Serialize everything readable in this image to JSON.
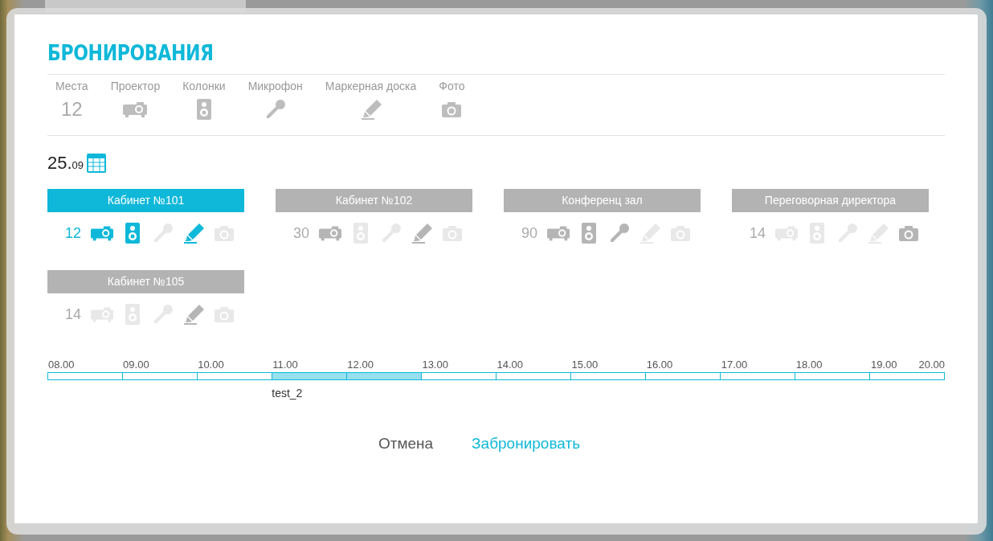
{
  "dialog": {
    "title": "БРОНИРОВАНИЯ",
    "legend": [
      {
        "kind": "seats",
        "label": "Места",
        "value": "12"
      },
      {
        "kind": "projector",
        "label": "Проектор"
      },
      {
        "kind": "speaker",
        "label": "Колонки"
      },
      {
        "kind": "mic",
        "label": "Микрофон"
      },
      {
        "kind": "marker",
        "label": "Маркерная доска"
      },
      {
        "kind": "camera",
        "label": "Фото"
      }
    ],
    "date": {
      "day": "25.",
      "month": "09"
    },
    "rooms": [
      {
        "name": "Кабинет №101",
        "selected": true,
        "seats": "12",
        "features": [
          {
            "kind": "projector",
            "available": true
          },
          {
            "kind": "speaker",
            "available": true
          },
          {
            "kind": "mic",
            "available": false
          },
          {
            "kind": "marker",
            "available": true
          },
          {
            "kind": "camera",
            "available": false
          }
        ]
      },
      {
        "name": "Кабинет №102",
        "selected": false,
        "seats": "30",
        "features": [
          {
            "kind": "projector",
            "available": true
          },
          {
            "kind": "speaker",
            "available": false
          },
          {
            "kind": "mic",
            "available": false
          },
          {
            "kind": "marker",
            "available": true
          },
          {
            "kind": "camera",
            "available": false
          }
        ]
      },
      {
        "name": "Конференц зал",
        "selected": false,
        "seats": "90",
        "features": [
          {
            "kind": "projector",
            "available": true
          },
          {
            "kind": "speaker",
            "available": true
          },
          {
            "kind": "mic",
            "available": true
          },
          {
            "kind": "marker",
            "available": false
          },
          {
            "kind": "camera",
            "available": false
          }
        ]
      },
      {
        "name": "Переговорная директора",
        "selected": false,
        "seats": "14",
        "features": [
          {
            "kind": "projector",
            "available": false
          },
          {
            "kind": "speaker",
            "available": false
          },
          {
            "kind": "mic",
            "available": false
          },
          {
            "kind": "marker",
            "available": false
          },
          {
            "kind": "camera",
            "available": true
          }
        ]
      },
      {
        "name": "Кабинет №105",
        "selected": false,
        "seats": "14",
        "features": [
          {
            "kind": "projector",
            "available": false
          },
          {
            "kind": "speaker",
            "available": false
          },
          {
            "kind": "mic",
            "available": false
          },
          {
            "kind": "marker",
            "available": true
          },
          {
            "kind": "camera",
            "available": false
          }
        ]
      }
    ],
    "timeline": {
      "hours": [
        "08.00",
        "09.00",
        "10.00",
        "11.00",
        "12.00",
        "13.00",
        "14.00",
        "15.00",
        "16.00",
        "17.00",
        "18.00",
        "19.00",
        "20.00"
      ],
      "slots": [
        {
          "booked": false
        },
        {
          "booked": false
        },
        {
          "booked": false
        },
        {
          "booked": true,
          "label": "test_2"
        },
        {
          "booked": true
        },
        {
          "booked": false
        },
        {
          "booked": false
        },
        {
          "booked": false
        },
        {
          "booked": false
        },
        {
          "booked": false
        },
        {
          "booked": false
        },
        {
          "booked": false
        }
      ]
    },
    "buttons": [
      {
        "kind": "cancel",
        "label": "Отмена"
      },
      {
        "kind": "confirm",
        "label": "Забронировать"
      }
    ]
  }
}
